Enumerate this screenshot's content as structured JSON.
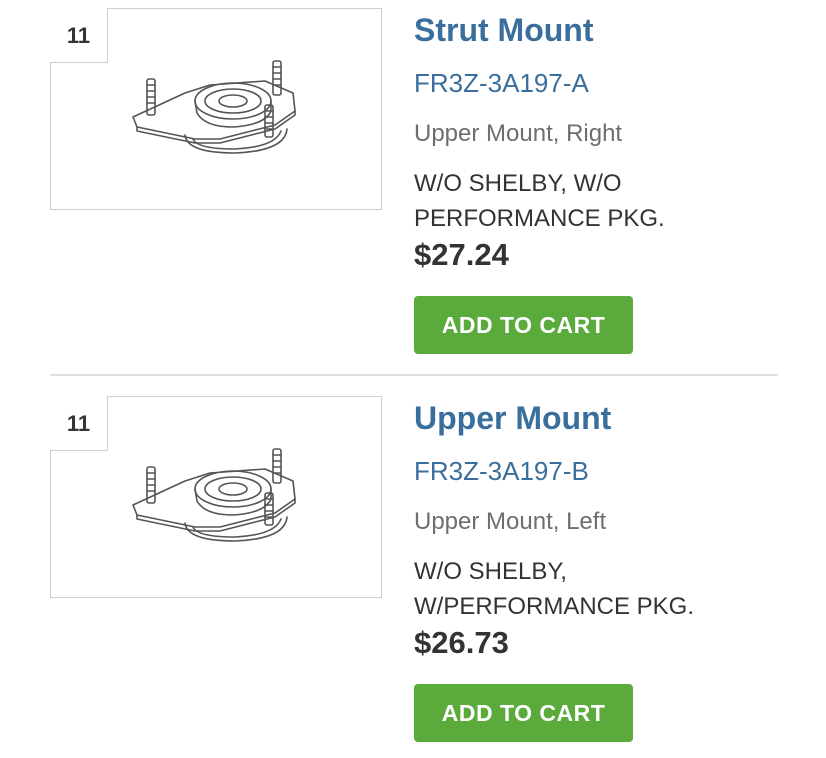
{
  "products": [
    {
      "ref_number": "11",
      "title": "Strut Mount",
      "part_number": "FR3Z-3A197-A",
      "description": "Upper Mount, Right",
      "notes": "W/O SHELBY, W/O PERFORMANCE PKG.",
      "price": "$27.24",
      "button_label": "ADD TO CART",
      "image_icon": "strut-mount-drawing"
    },
    {
      "ref_number": "11",
      "title": "Upper Mount",
      "part_number": "FR3Z-3A197-B",
      "description": "Upper Mount, Left",
      "notes": "W/O SHELBY, W/PERFORMANCE PKG.",
      "price": "$26.73",
      "button_label": "ADD TO CART",
      "image_icon": "strut-mount-drawing"
    }
  ],
  "colors": {
    "title": "#3a6f9d",
    "button": "#5aaa3c",
    "price": "#333333",
    "description": "#6e6e6e"
  }
}
